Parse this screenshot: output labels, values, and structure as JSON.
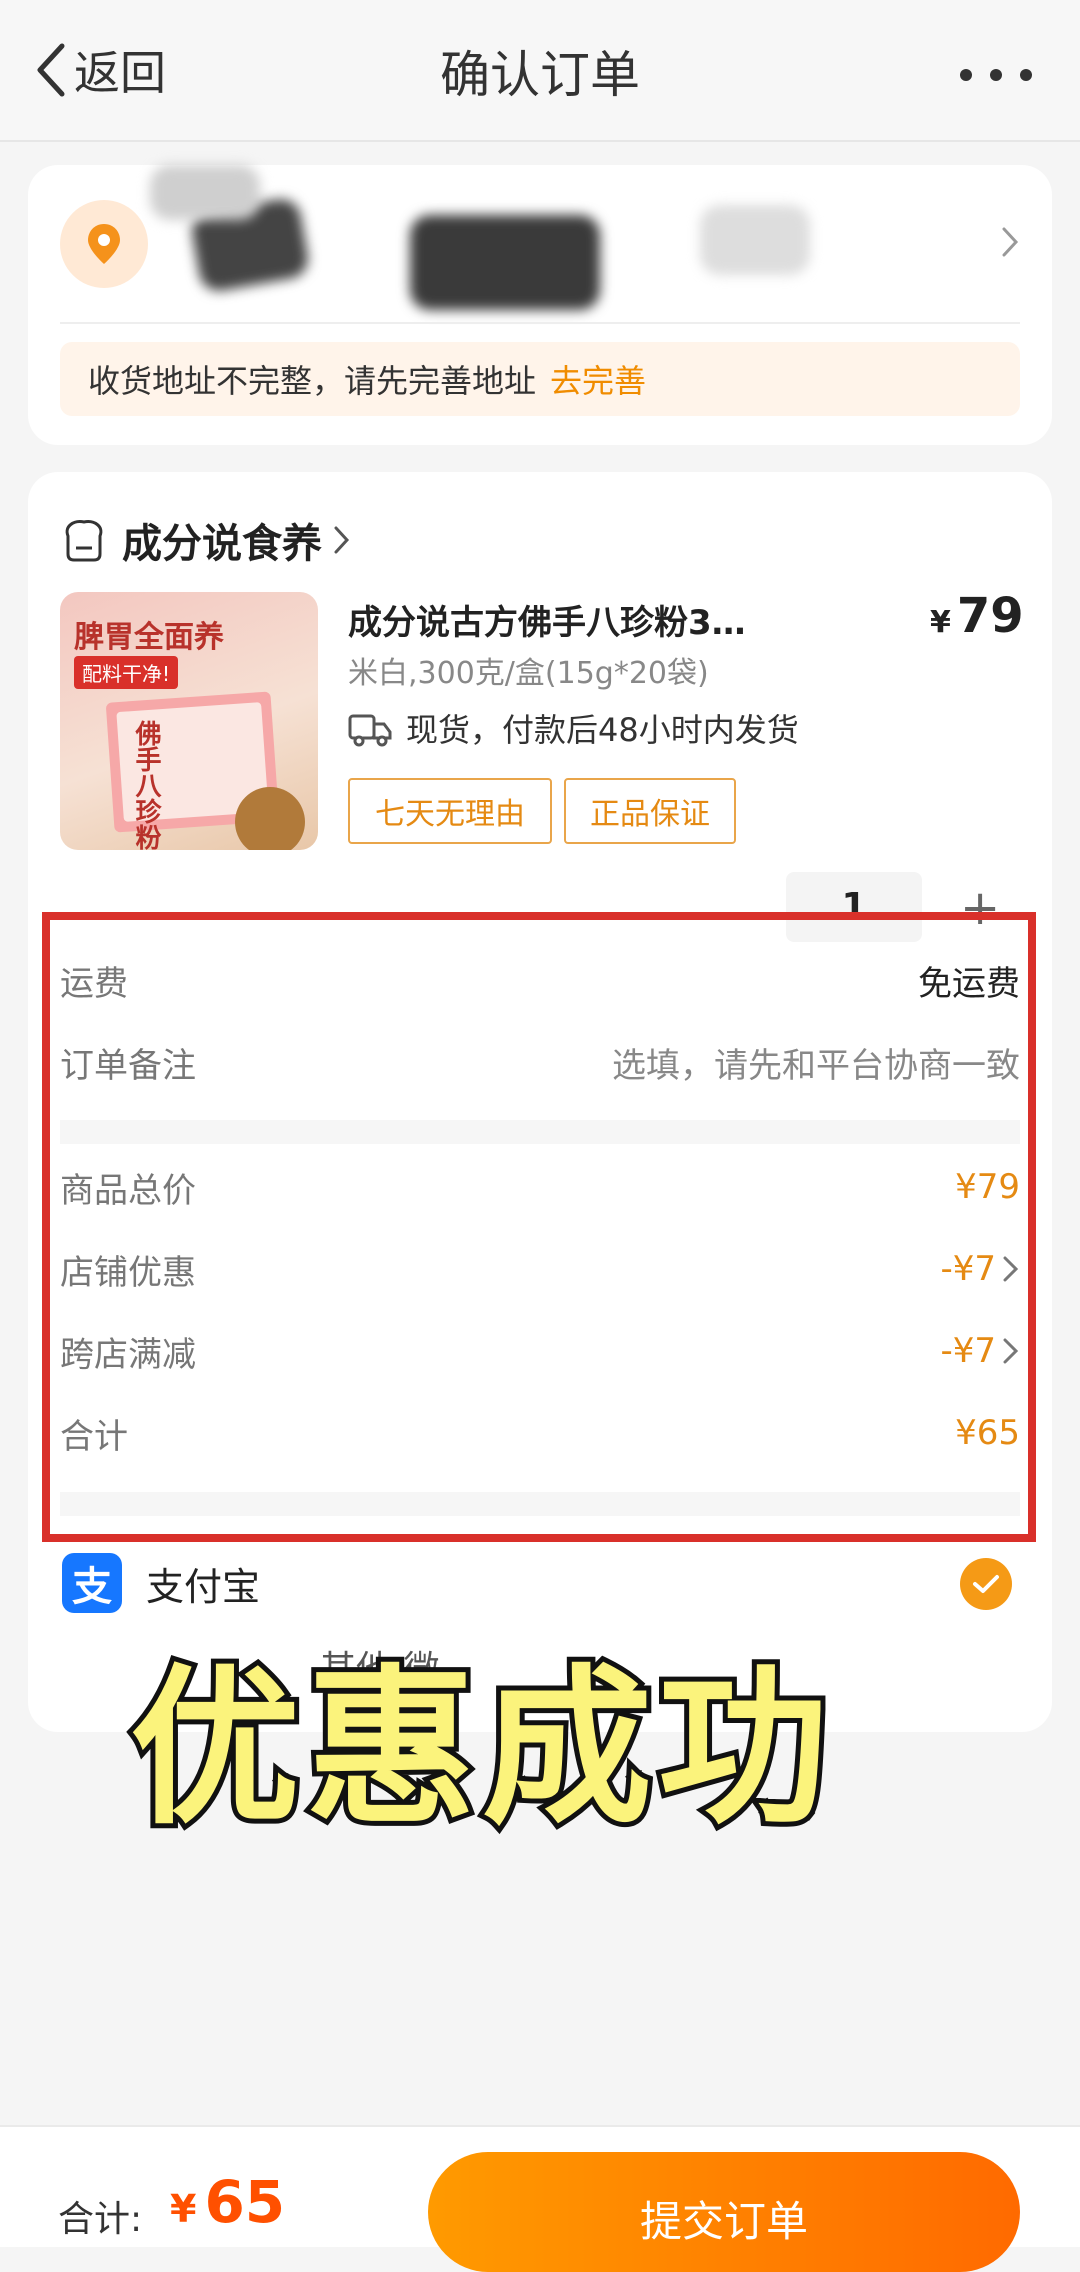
{
  "header": {
    "back_label": "返回",
    "title": "确认订单"
  },
  "address": {
    "notice": "收货地址不完整，请先完善地址",
    "notice_action": "去完善"
  },
  "shop": {
    "name": "成分说食养"
  },
  "product": {
    "image_title": "脾胃全面养",
    "image_tag": "配料干净!",
    "image_box_text": "佛手八珍粉",
    "name": "成分说古方佛手八珍粉3…",
    "price_symbol": "¥",
    "price": "79",
    "spec": "米白,300克/盒(15g*20袋)",
    "shipping": "现货，付款后48小时内发货",
    "tags": [
      "七天无理由",
      "正品保证"
    ],
    "quantity": "1"
  },
  "fees": {
    "freight_label": "运费",
    "freight_value": "免运费",
    "remark_label": "订单备注",
    "remark_placeholder": "选填，请先和平台协商一致"
  },
  "summary": {
    "items_total_label": "商品总价",
    "items_total_value": "¥79",
    "shop_discount_label": "店铺优惠",
    "shop_discount_value": "-¥7",
    "cross_discount_label": "跨店满减",
    "cross_discount_value": "-¥7",
    "total_label": "合计",
    "total_value": "¥65"
  },
  "payment": {
    "method": "支付宝",
    "alipay_glyph": "支",
    "other_text": "其他    微"
  },
  "overlay": {
    "text": "优惠成功"
  },
  "footer": {
    "total_label": "合计:",
    "total_symbol": "¥",
    "total_value": "65",
    "submit_label": "提交订单"
  },
  "colors": {
    "accent": "#ff6a00",
    "orange_text": "#e58a13",
    "highlight_border": "#d9302a",
    "alipay_blue": "#1677ff"
  }
}
